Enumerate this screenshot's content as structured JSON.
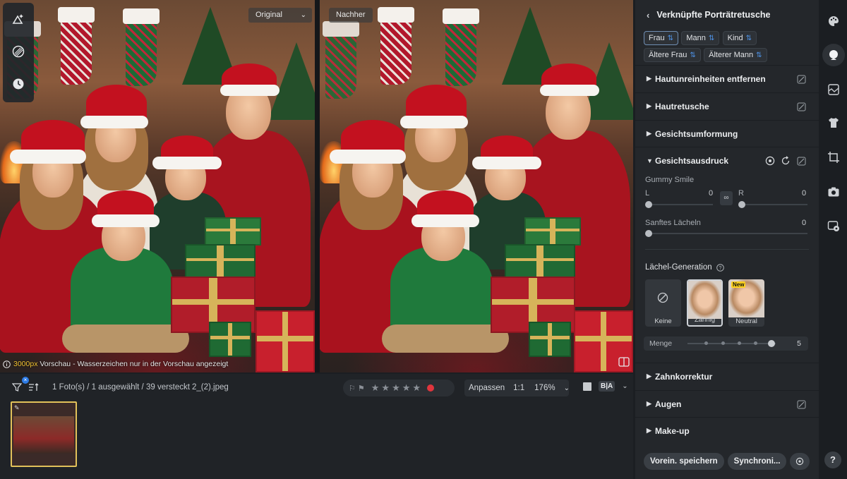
{
  "preview": {
    "original_label": "Original",
    "after_label": "Nachher",
    "watermark_prefix": "3000px",
    "watermark_text": " Vorschau - Wasserzeichen nur in der Vorschau angezeigt"
  },
  "left_tools": [
    "people-edit-icon",
    "texture-icon",
    "history-icon"
  ],
  "bottombar": {
    "count_text": "1 Foto(s) / 1 ausgewählt / 39 versteckt",
    "file_name": "2_(2).jpeg",
    "rating_stars": 5,
    "fit_label": "Anpassen",
    "ratio_label": "1:1",
    "zoom_label": "176%",
    "compare_label": "B|A"
  },
  "panel": {
    "title": "Verknüpfte Porträtretusche",
    "chips": [
      "Frau",
      "Mann",
      "Kind",
      "Ältere Frau",
      "Älterer Mann"
    ],
    "sections": {
      "s1": "Hautunreinheiten entfernen",
      "s2": "Hautretusche",
      "s3": "Gesichtsumformung",
      "s4": "Gesichtsausdruck",
      "s5": "Zahnkorrektur",
      "s6": "Augen",
      "s7": "Make-up"
    },
    "gummy": {
      "label": "Gummy Smile",
      "l_label": "L",
      "l_value": "0",
      "r_label": "R",
      "r_value": "0"
    },
    "soft": {
      "label": "Sanftes Lächeln",
      "value": "0"
    },
    "generation": {
      "title": "Lächel-Generation",
      "options": {
        "none": "Keine",
        "teeth": "Zahnig",
        "neutral": "Neutral"
      },
      "new_badge": "New",
      "amount_label": "Menge",
      "amount_value": "5"
    },
    "save_preset": "Vorein. speichern",
    "sync": "Synchroni..."
  },
  "rail": {
    "help": "?"
  }
}
